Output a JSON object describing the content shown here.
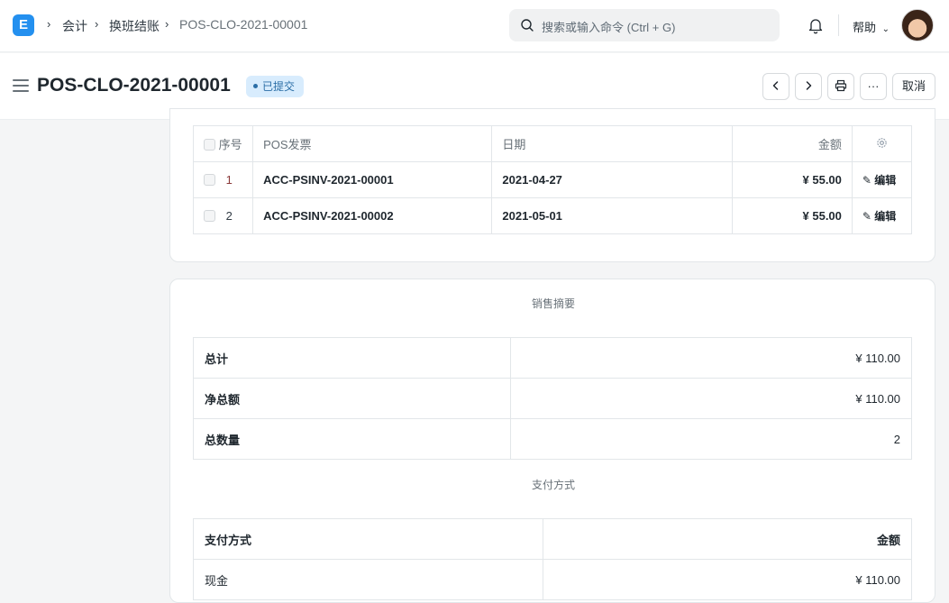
{
  "navbar": {
    "logo_letter": "E",
    "breadcrumbs": [
      "会计",
      "换班结账",
      "POS-CLO-2021-00001"
    ],
    "search_placeholder": "搜索或输入命令 (Ctrl + G)",
    "help_label": "帮助"
  },
  "page": {
    "title": "POS-CLO-2021-00001",
    "status": "已提交",
    "cancel_label": "取消",
    "more_label": "···"
  },
  "invoices": {
    "headers": [
      "序号",
      "POS发票",
      "日期",
      "金额"
    ],
    "rows": [
      {
        "idx": "1",
        "invoice": "ACC-PSINV-2021-00001",
        "date": "2021-04-27",
        "amount": "¥ 55.00",
        "edit": "编辑"
      },
      {
        "idx": "2",
        "invoice": "ACC-PSINV-2021-00002",
        "date": "2021-05-01",
        "amount": "¥ 55.00",
        "edit": "编辑"
      }
    ]
  },
  "summary": {
    "section_title": "销售摘要",
    "rows": [
      {
        "label": "总计",
        "value": "¥ 110.00"
      },
      {
        "label": "净总额",
        "value": "¥ 110.00"
      },
      {
        "label": "总数量",
        "value": "2"
      }
    ]
  },
  "payments": {
    "section_title": "支付方式",
    "headers": [
      "支付方式",
      "金额"
    ],
    "rows": [
      {
        "mode": "现金",
        "amount": "¥ 110.00"
      }
    ]
  }
}
